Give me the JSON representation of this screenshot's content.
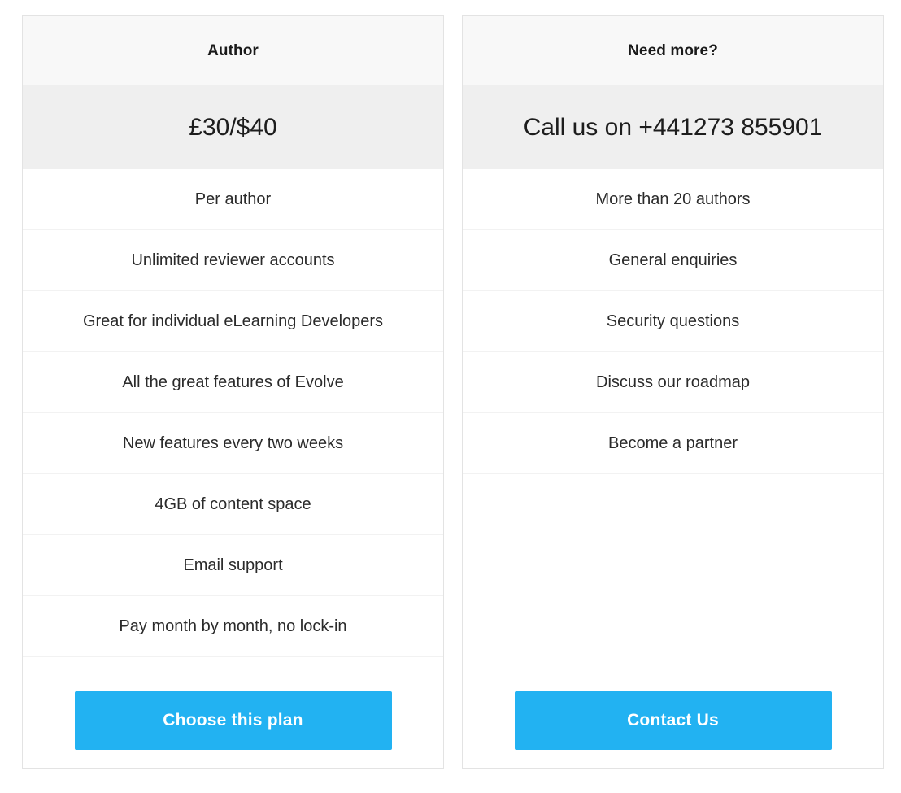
{
  "page": {
    "title": "Pricing Plans",
    "accent_color": "#22b2f2",
    "header_band_color": "#f8f8f8",
    "price_band_color": "#efefef",
    "card_border_color": "#e3e3e3",
    "divider_color": "#f2f2f2"
  },
  "plans": [
    {
      "id": "author",
      "title": "Author",
      "price": "£30/$40",
      "features": [
        "Per author",
        "Unlimited reviewer accounts",
        "Great for individual eLearning Developers",
        "All the great features of Evolve",
        "New features every two weeks",
        "4GB of content space",
        "Email support",
        "Pay month by month, no lock-in"
      ],
      "cta_label": "Choose this plan"
    },
    {
      "id": "need-more",
      "title": "Need more?",
      "price": "Call us on +441273 855901",
      "features": [
        "More than 20 authors",
        "General enquiries",
        "Security questions",
        "Discuss our roadmap",
        "Become a partner"
      ],
      "cta_label": "Contact Us"
    }
  ]
}
